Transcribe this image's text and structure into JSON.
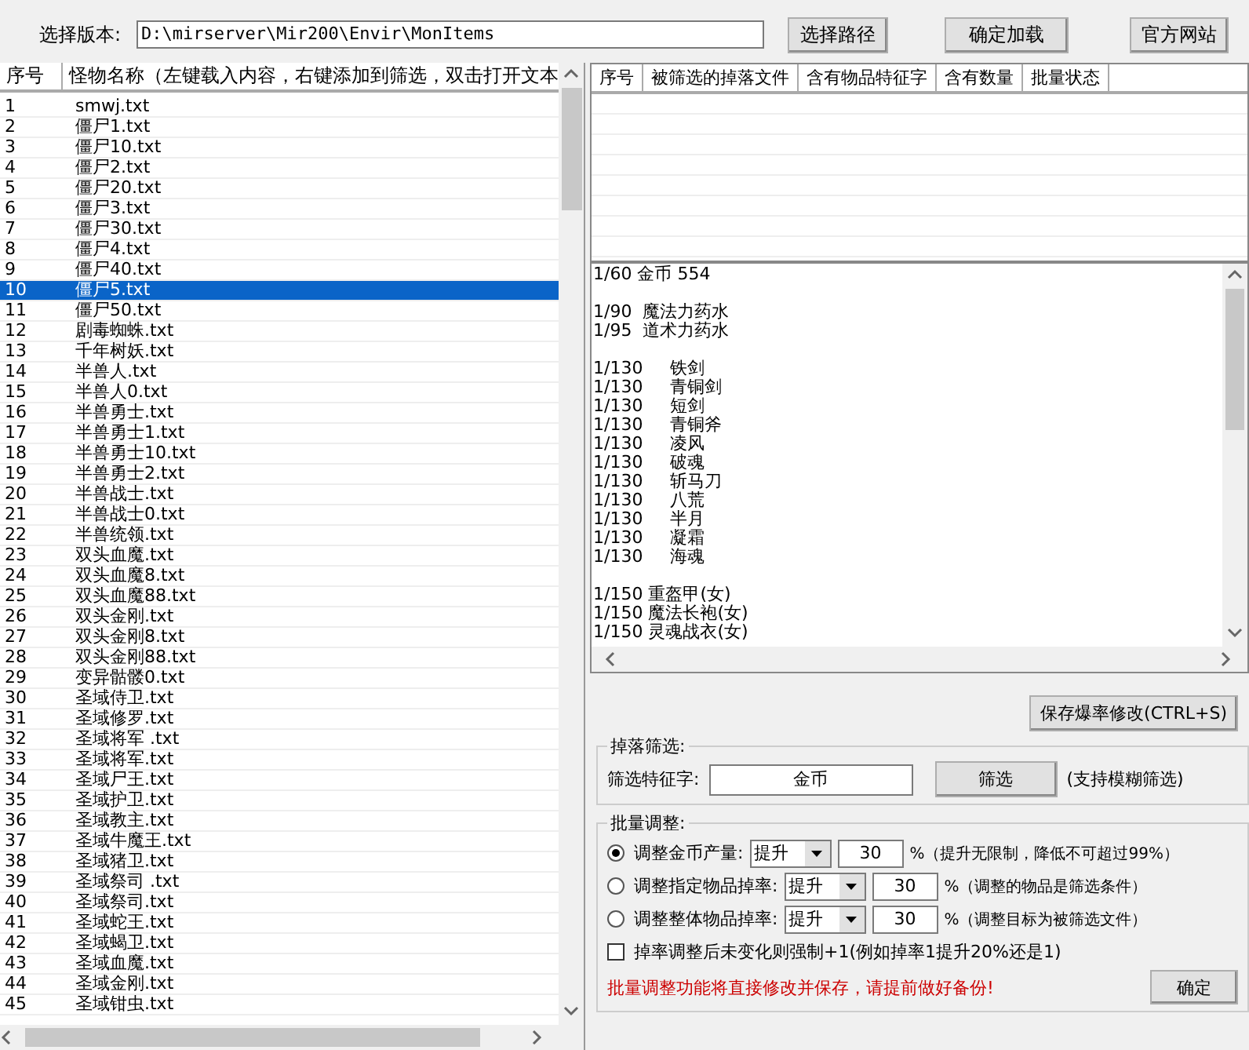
{
  "path_bar": {
    "label": "选择版本:",
    "value": "D:\\mirserver\\Mir200\\Envir\\MonItems",
    "buttons": [
      "选择路径",
      "确定加载",
      "官方网站"
    ]
  },
  "monster_list": {
    "columns": [
      "序号",
      "怪物名称（左键载入内容，右键添加到筛选，双击打开文本"
    ],
    "rows": [
      {
        "no": "1",
        "name": "smwj.txt",
        "selected": false
      },
      {
        "no": "2",
        "name": "僵尸1.txt",
        "selected": false
      },
      {
        "no": "3",
        "name": "僵尸10.txt",
        "selected": false
      },
      {
        "no": "4",
        "name": "僵尸2.txt",
        "selected": false
      },
      {
        "no": "5",
        "name": "僵尸20.txt",
        "selected": false
      },
      {
        "no": "6",
        "name": "僵尸3.txt",
        "selected": false
      },
      {
        "no": "7",
        "name": "僵尸30.txt",
        "selected": false
      },
      {
        "no": "8",
        "name": "僵尸4.txt",
        "selected": false
      },
      {
        "no": "9",
        "name": "僵尸40.txt",
        "selected": false
      },
      {
        "no": "10",
        "name": "僵尸5.txt",
        "selected": true
      },
      {
        "no": "11",
        "name": "僵尸50.txt",
        "selected": false
      },
      {
        "no": "12",
        "name": "剧毒蜘蛛.txt",
        "selected": false
      },
      {
        "no": "13",
        "name": "千年树妖.txt",
        "selected": false
      },
      {
        "no": "14",
        "name": "半兽人.txt",
        "selected": false
      },
      {
        "no": "15",
        "name": "半兽人0.txt",
        "selected": false
      },
      {
        "no": "16",
        "name": "半兽勇士.txt",
        "selected": false
      },
      {
        "no": "17",
        "name": "半兽勇士1.txt",
        "selected": false
      },
      {
        "no": "18",
        "name": "半兽勇士10.txt",
        "selected": false
      },
      {
        "no": "19",
        "name": "半兽勇士2.txt",
        "selected": false
      },
      {
        "no": "20",
        "name": "半兽战士.txt",
        "selected": false
      },
      {
        "no": "21",
        "name": "半兽战士0.txt",
        "selected": false
      },
      {
        "no": "22",
        "name": "半兽统领.txt",
        "selected": false
      },
      {
        "no": "23",
        "name": "双头血魔.txt",
        "selected": false
      },
      {
        "no": "24",
        "name": "双头血魔8.txt",
        "selected": false
      },
      {
        "no": "25",
        "name": "双头血魔88.txt",
        "selected": false
      },
      {
        "no": "26",
        "name": "双头金刚.txt",
        "selected": false
      },
      {
        "no": "27",
        "name": "双头金刚8.txt",
        "selected": false
      },
      {
        "no": "28",
        "name": "双头金刚88.txt",
        "selected": false
      },
      {
        "no": "29",
        "name": "变异骷髅0.txt",
        "selected": false
      },
      {
        "no": "30",
        "name": "圣域侍卫.txt",
        "selected": false
      },
      {
        "no": "31",
        "name": "圣域修罗.txt",
        "selected": false
      },
      {
        "no": "32",
        "name": "圣域将军 .txt",
        "selected": false
      },
      {
        "no": "33",
        "name": "圣域将军.txt",
        "selected": false
      },
      {
        "no": "34",
        "name": "圣域尸王.txt",
        "selected": false
      },
      {
        "no": "35",
        "name": "圣域护卫.txt",
        "selected": false
      },
      {
        "no": "36",
        "name": "圣域教主.txt",
        "selected": false
      },
      {
        "no": "37",
        "name": "圣域牛魔王.txt",
        "selected": false
      },
      {
        "no": "38",
        "name": "圣域猪卫.txt",
        "selected": false
      },
      {
        "no": "39",
        "name": "圣域祭司 .txt",
        "selected": false
      },
      {
        "no": "40",
        "name": "圣域祭司.txt",
        "selected": false
      },
      {
        "no": "41",
        "name": "圣域蛇王.txt",
        "selected": false
      },
      {
        "no": "42",
        "name": "圣域蝎卫.txt",
        "selected": false
      },
      {
        "no": "43",
        "name": "圣域血魔.txt",
        "selected": false
      },
      {
        "no": "44",
        "name": "圣域金刚.txt",
        "selected": false
      },
      {
        "no": "45",
        "name": "圣域钳虫.txt",
        "selected": false
      }
    ]
  },
  "filter_table": {
    "columns": [
      "序号",
      "被筛选的掉落文件",
      "含有物品特征字",
      "含有数量",
      "批量状态"
    ]
  },
  "drop_text": [
    [
      "1/60 金币 554"
    ],
    [
      "1/90  魔法力药水",
      "1/95  道术力药水"
    ],
    [
      "1/130     铁剑",
      "1/130     青铜剑",
      "1/130     短剑",
      "1/130     青铜斧",
      "1/130     凌风",
      "1/130     破魂",
      "1/130     斩马刀",
      "1/130     八荒",
      "1/130     半月",
      "1/130     凝霜",
      "1/130     海魂"
    ],
    [
      "1/150 重盔甲(女)",
      "1/150 魔法长袍(女)",
      "1/150 灵魂战衣(女)"
    ]
  ],
  "save_button": "保存爆率修改(CTRL+S)",
  "drop_filter": {
    "title": "掉落筛选:",
    "label": "筛选特征字:",
    "value": "金币",
    "button": "筛选",
    "hint": "(支持模糊筛选)"
  },
  "batch": {
    "title": "批量调整:",
    "options": [
      {
        "kind": "radio",
        "label": "调整金币产量:",
        "selected": true,
        "mode": "提升",
        "amount": "30",
        "note": "%（提升无限制，降低不可超过99%）"
      },
      {
        "kind": "radio",
        "label": "调整指定物品掉率:",
        "selected": false,
        "mode": "提升",
        "amount": "30",
        "note": "%（调整的物品是筛选条件）"
      },
      {
        "kind": "radio",
        "label": "调整整体物品掉率:",
        "selected": false,
        "mode": "提升",
        "amount": "30",
        "note": "%（调整目标为被筛选文件）"
      },
      {
        "kind": "checkbox",
        "label": "掉率调整后未变化则强制+1(例如掉率1提升20%还是1)",
        "checked": false
      }
    ],
    "warning": "批量调整功能将直接修改并保存，请提前做好备份!",
    "confirm": "确定"
  }
}
